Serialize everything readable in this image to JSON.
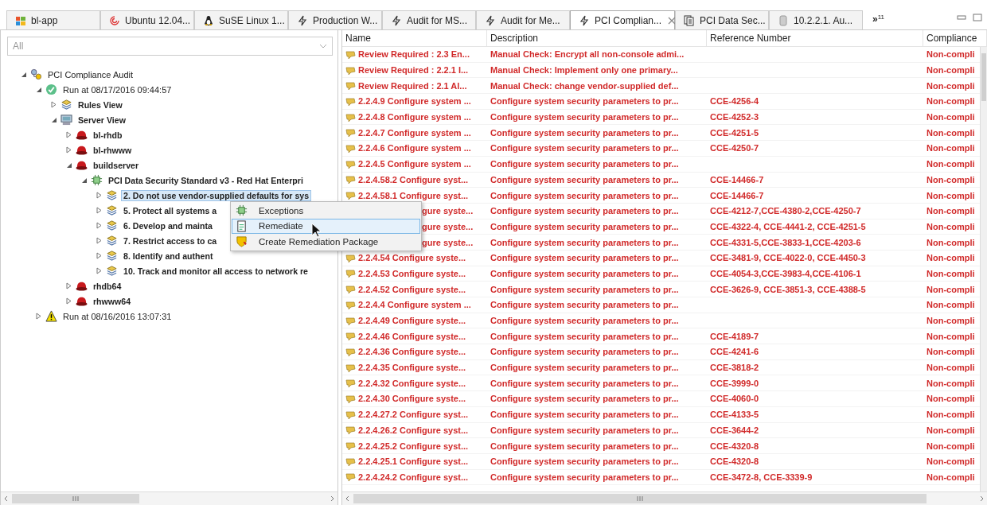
{
  "tabs": [
    {
      "label": "bl-app",
      "kind": "app",
      "selected": false
    },
    {
      "label": "Ubuntu 12.04...",
      "kind": "swirl",
      "selected": false
    },
    {
      "label": "SuSE Linux 1...",
      "kind": "penguin",
      "selected": false
    },
    {
      "label": "Production W...",
      "kind": "bolt",
      "selected": false
    },
    {
      "label": "Audit for MS...",
      "kind": "bolt",
      "selected": false
    },
    {
      "label": "Audit for Me...",
      "kind": "bolt",
      "selected": false
    },
    {
      "label": "PCI Complian...",
      "kind": "bolt",
      "selected": true
    },
    {
      "label": "PCI Data Sec...",
      "kind": "doc",
      "selected": false
    },
    {
      "label": "10.2.2.1. Au...",
      "kind": "db",
      "selected": false
    }
  ],
  "overflow": {
    "label": "»",
    "count": "11"
  },
  "filter": {
    "value": "All"
  },
  "tree": [
    {
      "label": "PCI Compliance Audit",
      "kind": "audit",
      "expanded": true,
      "selected": false,
      "children": [
        {
          "label": "Run at 08/17/2016 09:44:57",
          "kind": "run-ok",
          "expanded": true,
          "selected": false,
          "children": [
            {
              "label": "Rules View",
              "kind": "rules",
              "expanded": false,
              "selected": false
            },
            {
              "label": "Server View",
              "kind": "server-view",
              "expanded": true,
              "selected": false,
              "children": [
                {
                  "label": "bl-rhdb",
                  "kind": "server",
                  "expanded": false,
                  "selected": false
                },
                {
                  "label": "bl-rhwww",
                  "kind": "server",
                  "expanded": false,
                  "selected": false
                },
                {
                  "label": "buildserver",
                  "kind": "server",
                  "expanded": true,
                  "selected": false,
                  "children": [
                    {
                      "label": "PCI Data Security Standard v3 - Red Hat Enterpri",
                      "kind": "standard",
                      "expanded": true,
                      "selected": false,
                      "children": [
                        {
                          "label": "2. Do not use vendor-supplied defaults for sys",
                          "kind": "rules",
                          "expanded": false,
                          "selected": true
                        },
                        {
                          "label": "5. Protect all systems a",
                          "kind": "rules",
                          "expanded": false,
                          "selected": false
                        },
                        {
                          "label": "6. Develop and mainta",
                          "kind": "rules",
                          "expanded": false,
                          "selected": false
                        },
                        {
                          "label": "7. Restrict access to ca",
                          "kind": "rules",
                          "expanded": false,
                          "selected": false
                        },
                        {
                          "label": "8. Identify and authent",
                          "kind": "rules",
                          "expanded": false,
                          "selected": false
                        },
                        {
                          "label": "10. Track and monitor all access to network re",
                          "kind": "rules",
                          "expanded": false,
                          "selected": false
                        }
                      ]
                    }
                  ]
                },
                {
                  "label": "rhdb64",
                  "kind": "server",
                  "expanded": false,
                  "selected": false
                },
                {
                  "label": "rhwww64",
                  "kind": "server",
                  "expanded": false,
                  "selected": false
                }
              ]
            }
          ]
        },
        {
          "label": "Run at 08/16/2016 13:07:31",
          "kind": "run-warning",
          "expanded": false,
          "selected": false
        }
      ]
    }
  ],
  "context_menu": [
    {
      "label": "Exceptions",
      "kind": "exceptions",
      "selected": false
    },
    {
      "label": "Remediate",
      "kind": "remediate",
      "selected": true
    },
    {
      "label": "Create Remediation Package",
      "kind": "package",
      "selected": false
    }
  ],
  "table": {
    "columns": [
      "Name",
      "Description",
      "Reference Number",
      "Compliance"
    ],
    "rows": [
      {
        "name": "Review Required : 2.3 En...",
        "description": "Manual Check: Encrypt all non-console admi...",
        "reference": "",
        "compliance": "Non-compli"
      },
      {
        "name": "Review Required : 2.2.1 I...",
        "description": "Manual Check: Implement only one primary...",
        "reference": "",
        "compliance": "Non-compli"
      },
      {
        "name": "Review Required : 2.1 Al...",
        "description": "Manual Check: change vendor-supplied def...",
        "reference": "",
        "compliance": "Non-compli"
      },
      {
        "name": "2.2.4.9 Configure system ...",
        "description": "Configure system security parameters to pr...",
        "reference": "CCE-4256-4",
        "compliance": "Non-compli"
      },
      {
        "name": "2.2.4.8 Configure system ...",
        "description": "Configure system security parameters to pr...",
        "reference": "CCE-4252-3",
        "compliance": "Non-compli"
      },
      {
        "name": "2.2.4.7 Configure system ...",
        "description": "Configure system security parameters to pr...",
        "reference": "CCE-4251-5",
        "compliance": "Non-compli"
      },
      {
        "name": "2.2.4.6 Configure system ...",
        "description": "Configure system security parameters to pr...",
        "reference": "CCE-4250-7",
        "compliance": "Non-compli"
      },
      {
        "name": "2.2.4.5 Configure system ...",
        "description": "Configure system security parameters to pr...",
        "reference": "",
        "compliance": "Non-compli"
      },
      {
        "name": "2.2.4.58.2 Configure syst...",
        "description": "Configure system security parameters to pr...",
        "reference": "CCE-14466-7",
        "compliance": "Non-compli"
      },
      {
        "name": "2.2.4.58.1 Configure syst...",
        "description": "Configure system security parameters to pr...",
        "reference": "CCE-14466-7",
        "compliance": "Non-compli"
      },
      {
        "name": "gure syste...",
        "partly_hidden": true,
        "description": "Configure system security parameters to pr...",
        "reference": "CCE-4212-7,CCE-4380-2,CCE-4250-7",
        "compliance": "Non-compli"
      },
      {
        "name": "gure syste...",
        "partly_hidden": true,
        "description": "Configure system security parameters to pr...",
        "reference": "CCE-4322-4, CCE-4441-2, CCE-4251-5",
        "compliance": "Non-compli"
      },
      {
        "name": "gure syste...",
        "partly_hidden": true,
        "description": "Configure system security parameters to pr...",
        "reference": "CCE-4331-5,CCE-3833-1,CCE-4203-6",
        "compliance": "Non-compli"
      },
      {
        "name": "2.2.4.54 Configure syste...",
        "description": "Configure system security parameters to pr...",
        "reference": "CCE-3481-9, CCE-4022-0, CCE-4450-3",
        "compliance": "Non-compli"
      },
      {
        "name": "2.2.4.53 Configure syste...",
        "description": "Configure system security parameters to pr...",
        "reference": "CCE-4054-3,CCE-3983-4,CCE-4106-1",
        "compliance": "Non-compli"
      },
      {
        "name": "2.2.4.52 Configure syste...",
        "description": "Configure system security parameters to pr...",
        "reference": "CCE-3626-9, CCE-3851-3, CCE-4388-5",
        "compliance": "Non-compli"
      },
      {
        "name": "2.2.4.4 Configure system ...",
        "description": "Configure system security parameters to pr...",
        "reference": "",
        "compliance": "Non-compli"
      },
      {
        "name": "2.2.4.49 Configure syste...",
        "description": "Configure system security parameters to pr...",
        "reference": "",
        "compliance": "Non-compli"
      },
      {
        "name": "2.2.4.46 Configure syste...",
        "description": "Configure system security parameters to pr...",
        "reference": "CCE-4189-7",
        "compliance": "Non-compli"
      },
      {
        "name": "2.2.4.36 Configure syste...",
        "description": "Configure system security parameters to pr...",
        "reference": "CCE-4241-6",
        "compliance": "Non-compli"
      },
      {
        "name": "2.2.4.35 Configure syste...",
        "description": "Configure system security parameters to pr...",
        "reference": "CCE-3818-2",
        "compliance": "Non-compli"
      },
      {
        "name": "2.2.4.32 Configure syste...",
        "description": "Configure system security parameters to pr...",
        "reference": "CCE-3999-0",
        "compliance": "Non-compli"
      },
      {
        "name": "2.2.4.30 Configure syste...",
        "description": "Configure system security parameters to pr...",
        "reference": "CCE-4060-0",
        "compliance": "Non-compli"
      },
      {
        "name": "2.2.4.27.2 Configure syst...",
        "description": "Configure system security parameters to pr...",
        "reference": "CCE-4133-5",
        "compliance": "Non-compli"
      },
      {
        "name": "2.2.4.26.2 Configure syst...",
        "description": "Configure system security parameters to pr...",
        "reference": "CCE-3644-2",
        "compliance": "Non-compli"
      },
      {
        "name": "2.2.4.25.2 Configure syst...",
        "description": "Configure system security parameters to pr...",
        "reference": "CCE-4320-8",
        "compliance": "Non-compli"
      },
      {
        "name": "2.2.4.25.1 Configure syst...",
        "description": "Configure system security parameters to pr...",
        "reference": "CCE-4320-8",
        "compliance": "Non-compli"
      },
      {
        "name": "2.2.4.24.2 Configure syst...",
        "description": "Configure system security parameters to pr...",
        "reference": "CCE-3472-8, CCE-3339-9",
        "compliance": "Non-compli"
      }
    ]
  }
}
